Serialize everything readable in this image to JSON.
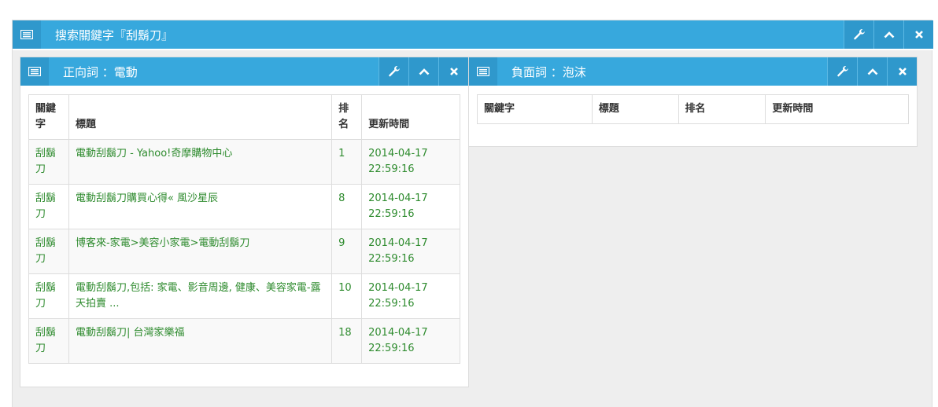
{
  "outer": {
    "title": "搜索關鍵字『刮鬍刀』",
    "icons": [
      "list-icon",
      "wrench-icon",
      "chevron-up-icon",
      "close-icon"
    ]
  },
  "positive": {
    "title": "正向詞 ：電動",
    "columns": [
      "關鍵字",
      "標題",
      "排名",
      "更新時間"
    ],
    "rows": [
      {
        "keyword": "刮鬍刀",
        "title": "電動刮鬍刀 - Yahoo!奇摩購物中心",
        "rank": "1",
        "time1": "2014-04-17",
        "time2": "22:59:16"
      },
      {
        "keyword": "刮鬍刀",
        "title": "電動刮鬍刀購買心得« 風沙星辰",
        "rank": "8",
        "time1": "2014-04-17",
        "time2": "22:59:16"
      },
      {
        "keyword": "刮鬍刀",
        "title": "博客來-家電>美容小家電>電動刮鬍刀",
        "rank": "9",
        "time1": "2014-04-17",
        "time2": "22:59:16"
      },
      {
        "keyword": "刮鬍刀",
        "title": "電動刮鬍刀,包括: 家電、影音周邊, 健康、美容家電-露天拍賣 ...",
        "rank": "10",
        "time1": "2014-04-17",
        "time2": "22:59:16"
      },
      {
        "keyword": "刮鬍刀",
        "title": "電動刮鬍刀| 台灣家樂福",
        "rank": "18",
        "time1": "2014-04-17",
        "time2": "22:59:16"
      }
    ]
  },
  "negative": {
    "title": "負面詞 ：泡沫",
    "columns": [
      "關鍵字",
      "標題",
      "排名",
      "更新時間"
    ]
  },
  "colors": {
    "header": "#37a8dd",
    "link_green": "#2e8b2e"
  }
}
